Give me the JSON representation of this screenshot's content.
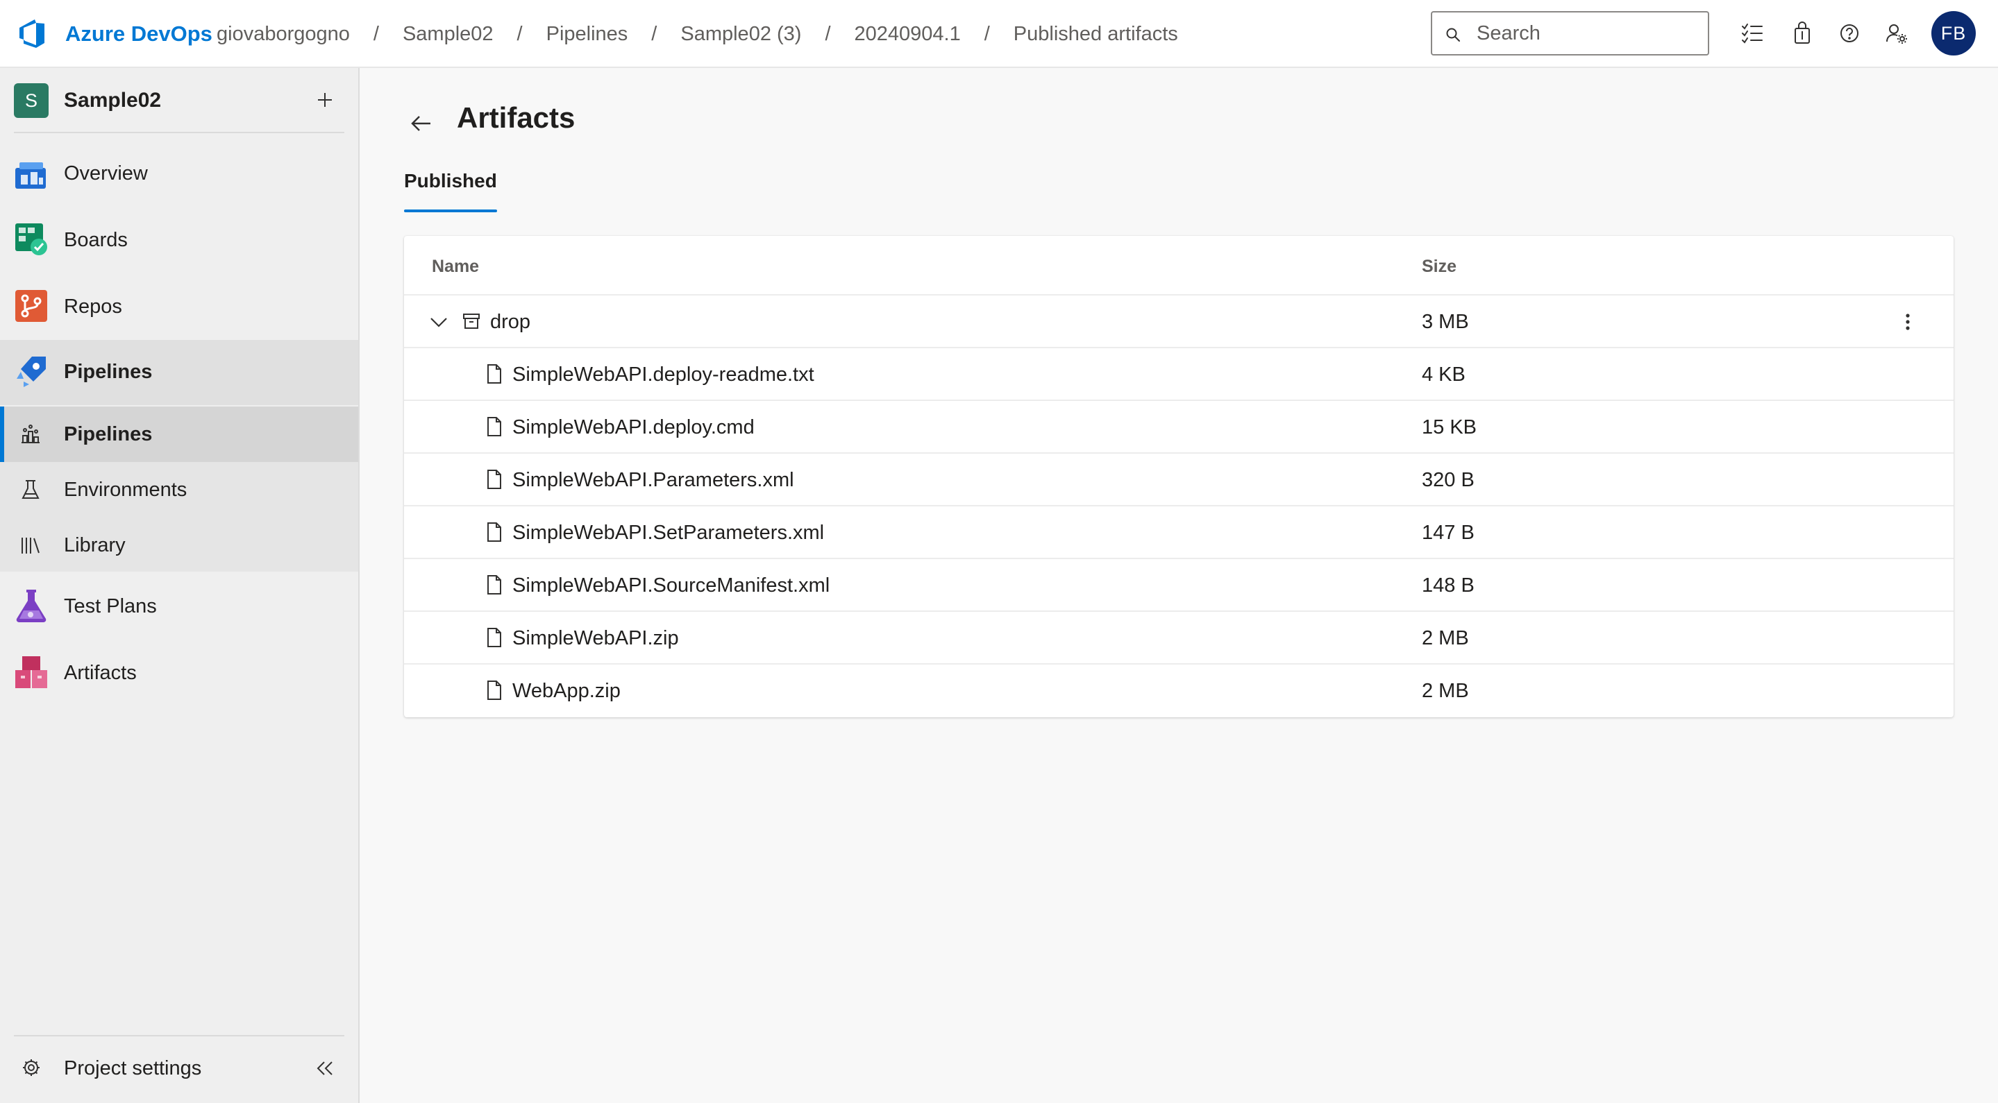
{
  "header": {
    "brand": "Azure DevOps",
    "breadcrumbs": [
      {
        "label": "giovaborgogno"
      },
      {
        "label": "Sample02"
      },
      {
        "label": "Pipelines"
      },
      {
        "label": "Sample02 (3)"
      },
      {
        "label": "20240904.1"
      },
      {
        "label": "Published artifacts"
      }
    ],
    "separator": "/",
    "search_placeholder": "Search",
    "search_value": "",
    "icons": [
      "search-icon",
      "task-list-icon",
      "shopping-bag-icon",
      "help-icon",
      "user-settings-icon"
    ],
    "avatar_initials": "FB",
    "avatar_color": "#0b2a6f"
  },
  "sidebar": {
    "project_initial": "S",
    "project_name": "Sample02",
    "project_color": "#2a7a63",
    "items": [
      {
        "label": "Overview",
        "icon": "overview-icon"
      },
      {
        "label": "Boards",
        "icon": "boards-icon"
      },
      {
        "label": "Repos",
        "icon": "repos-icon"
      },
      {
        "label": "Pipelines",
        "icon": "pipelines-icon"
      },
      {
        "label": "Test Plans",
        "icon": "test-plans-icon"
      },
      {
        "label": "Artifacts",
        "icon": "artifacts-icon"
      }
    ],
    "sub_items": [
      {
        "label": "Pipelines",
        "icon": "pipelines-sub-icon",
        "selected": true
      },
      {
        "label": "Environments",
        "icon": "environments-icon"
      },
      {
        "label": "Library",
        "icon": "library-icon"
      }
    ],
    "settings_label": "Project settings"
  },
  "main": {
    "title": "Artifacts",
    "tab_label": "Published",
    "accent": "#0078d4",
    "table": {
      "columns": [
        "Name",
        "Size"
      ],
      "folder": {
        "name": "drop",
        "size": "3 MB",
        "expanded": true
      },
      "files": [
        {
          "name": "SimpleWebAPI.deploy-readme.txt",
          "size": "4 KB"
        },
        {
          "name": "SimpleWebAPI.deploy.cmd",
          "size": "15 KB"
        },
        {
          "name": "SimpleWebAPI.Parameters.xml",
          "size": "320 B"
        },
        {
          "name": "SimpleWebAPI.SetParameters.xml",
          "size": "147 B"
        },
        {
          "name": "SimpleWebAPI.SourceManifest.xml",
          "size": "148 B"
        },
        {
          "name": "SimpleWebAPI.zip",
          "size": "2 MB"
        },
        {
          "name": "WebApp.zip",
          "size": "2 MB"
        }
      ]
    }
  }
}
